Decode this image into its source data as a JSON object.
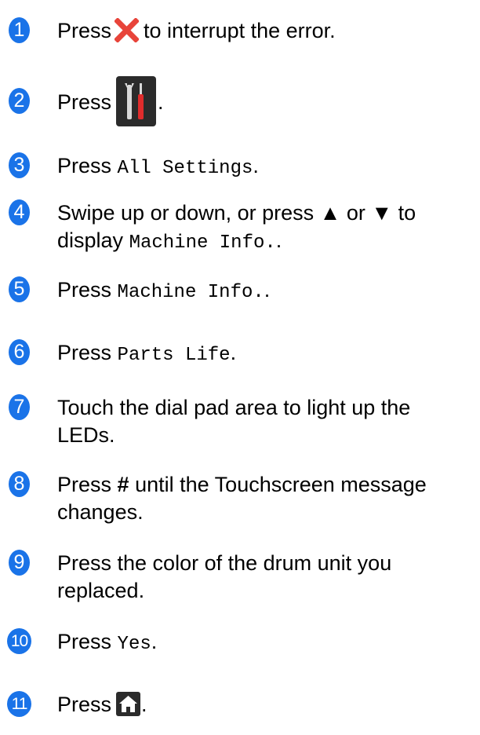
{
  "colors": {
    "badge": "#1a73e8",
    "cancel_icon": "#e8443a",
    "icon_bg": "#2b2b2b"
  },
  "steps": [
    {
      "num": "1",
      "before": "Press",
      "icon": "x-cancel-icon",
      "after": "to interrupt the error."
    },
    {
      "num": "2",
      "before": "Press",
      "icon": "settings-tools-icon",
      "after": "."
    },
    {
      "num": "3",
      "before": "Press",
      "code": "All Settings",
      "after": "."
    },
    {
      "num": "4",
      "line1": "Swipe up or down, or press ▲ or ▼ to",
      "line2_before": "display",
      "code": "Machine Info.",
      "after": "."
    },
    {
      "num": "5",
      "before": "Press",
      "code": "Machine Info.",
      "after": "."
    },
    {
      "num": "6",
      "before": "Press",
      "code": "Parts Life",
      "after": "."
    },
    {
      "num": "7",
      "text": "Touch the dial pad area to light up the LEDs."
    },
    {
      "num": "8",
      "before": "Press",
      "bold": "#",
      "after": "until the Touchscreen message changes."
    },
    {
      "num": "9",
      "text": "Press the color of the drum unit you replaced."
    },
    {
      "num": "10",
      "before": "Press",
      "code": "Yes",
      "after": "."
    },
    {
      "num": "11",
      "before": "Press",
      "icon": "home-icon",
      "after": "."
    }
  ]
}
